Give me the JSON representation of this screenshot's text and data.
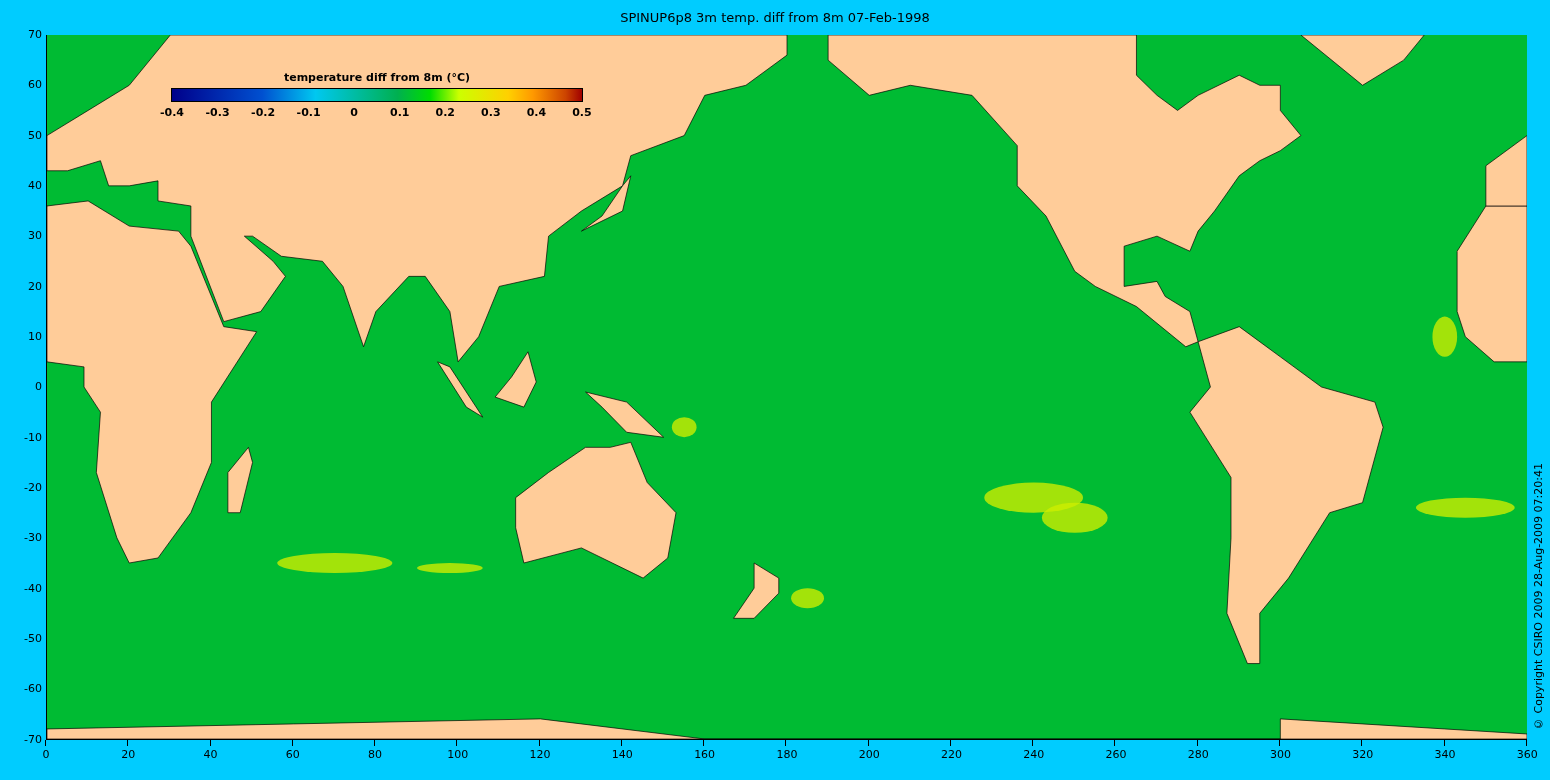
{
  "title": "SPINUP6p8 3m temp.  diff from 8m 07-Feb-1998",
  "colorbar": {
    "title": "temperature  diff from 8m (°C)",
    "ticks": [
      "-0.4",
      "-0.3",
      "-0.2",
      "-0.1",
      "0",
      "0.1",
      "0.2",
      "0.3",
      "0.4",
      "0.5"
    ]
  },
  "y_axis": {
    "ticks": [
      "70",
      "60",
      "50",
      "40",
      "30",
      "20",
      "10",
      "0",
      "-10",
      "-20",
      "-30",
      "-40",
      "-50",
      "-60",
      "-70"
    ]
  },
  "x_axis": {
    "ticks": [
      "0",
      "20",
      "40",
      "60",
      "80",
      "100",
      "120",
      "140",
      "160",
      "180",
      "200",
      "220",
      "240",
      "260",
      "280",
      "300",
      "320",
      "340",
      "360"
    ]
  },
  "copyright": "© Copyright CSIRO 2009   28-Aug-2009 07:20:41"
}
